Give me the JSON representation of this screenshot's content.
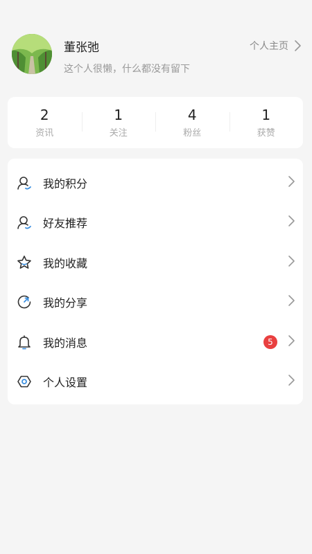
{
  "profile": {
    "name": "董张弛",
    "bio": "这个人很懒，什么都没有留下",
    "homepage_label": "个人主页"
  },
  "stats": [
    {
      "value": "2",
      "label": "资讯"
    },
    {
      "value": "1",
      "label": "关注"
    },
    {
      "value": "4",
      "label": "粉丝"
    },
    {
      "value": "1",
      "label": "获赞"
    }
  ],
  "menu": [
    {
      "label": "我的积分",
      "icon": "points-icon"
    },
    {
      "label": "好友推荐",
      "icon": "friends-icon"
    },
    {
      "label": "我的收藏",
      "icon": "star-icon"
    },
    {
      "label": "我的分享",
      "icon": "share-icon"
    },
    {
      "label": "我的消息",
      "icon": "bell-icon",
      "badge": "5"
    },
    {
      "label": "个人设置",
      "icon": "settings-icon"
    }
  ],
  "colors": {
    "background": "#f5f5f5",
    "card": "#ffffff",
    "badge": "#e94040",
    "accent": "#3b8fe0"
  }
}
